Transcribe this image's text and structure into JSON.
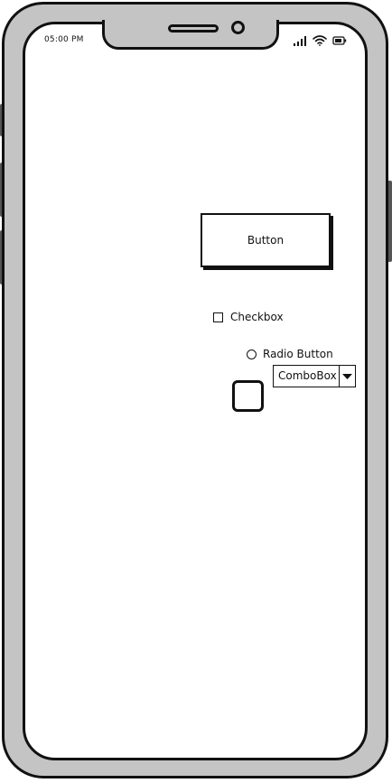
{
  "status_bar": {
    "time": "05:00 PM",
    "signal_icon": "cellular-signal-icon",
    "wifi_icon": "wifi-icon",
    "battery_icon": "battery-icon"
  },
  "widgets": {
    "button_label": "Button",
    "checkbox_label": "Checkbox",
    "checkbox_checked": false,
    "radio_label": "Radio Button",
    "radio_selected": false,
    "combobox_value": "ComboBox",
    "combobox_arrow_icon": "caret-down-icon"
  },
  "colors": {
    "frame_fill": "#c4c4c4",
    "stroke": "#111111",
    "screen": "#ffffff"
  }
}
